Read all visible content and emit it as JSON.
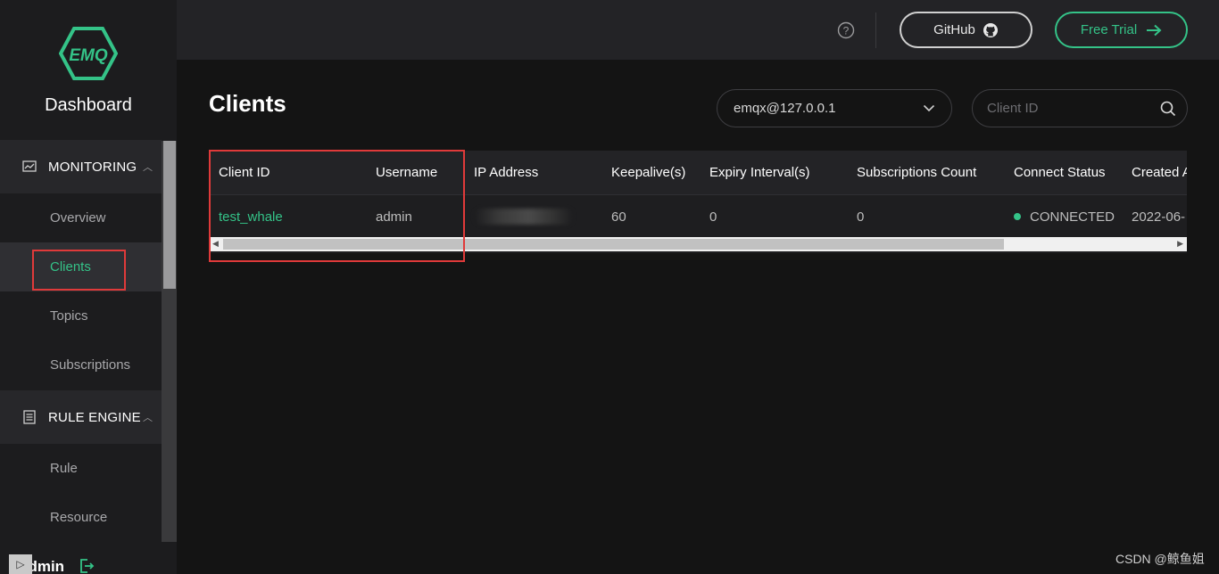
{
  "sidebar": {
    "logo_text": "EMQ",
    "brand": "Dashboard",
    "groups": [
      {
        "label": "MONITORING",
        "icon": "monitor-chart-icon",
        "items": [
          "Overview",
          "Clients",
          "Topics",
          "Subscriptions"
        ]
      },
      {
        "label": "RULE ENGINE",
        "icon": "document-list-icon",
        "items": [
          "Rule",
          "Resource"
        ]
      }
    ],
    "active_item": "Clients",
    "user": "admin"
  },
  "header": {
    "help_icon": "question-circle-icon",
    "github_label": "GitHub",
    "trial_label": "Free Trial"
  },
  "main": {
    "title": "Clients",
    "node_select": "emqx@127.0.0.1",
    "search_placeholder": "Client ID",
    "table": {
      "columns": [
        "Client ID",
        "Username",
        "IP Address",
        "Keepalive(s)",
        "Expiry Interval(s)",
        "Subscriptions Count",
        "Connect Status",
        "Created A"
      ],
      "rows": [
        {
          "client_id": "test_whale",
          "username": "admin",
          "ip": "",
          "keepalive": "60",
          "expiry": "0",
          "subscriptions": "0",
          "status": "CONNECTED",
          "created": "2022-06-"
        }
      ]
    }
  },
  "watermark": "CSDN @鲸鱼姐",
  "colors": {
    "accent": "#34c388",
    "highlight": "#e03a3a",
    "background": "#141414"
  }
}
